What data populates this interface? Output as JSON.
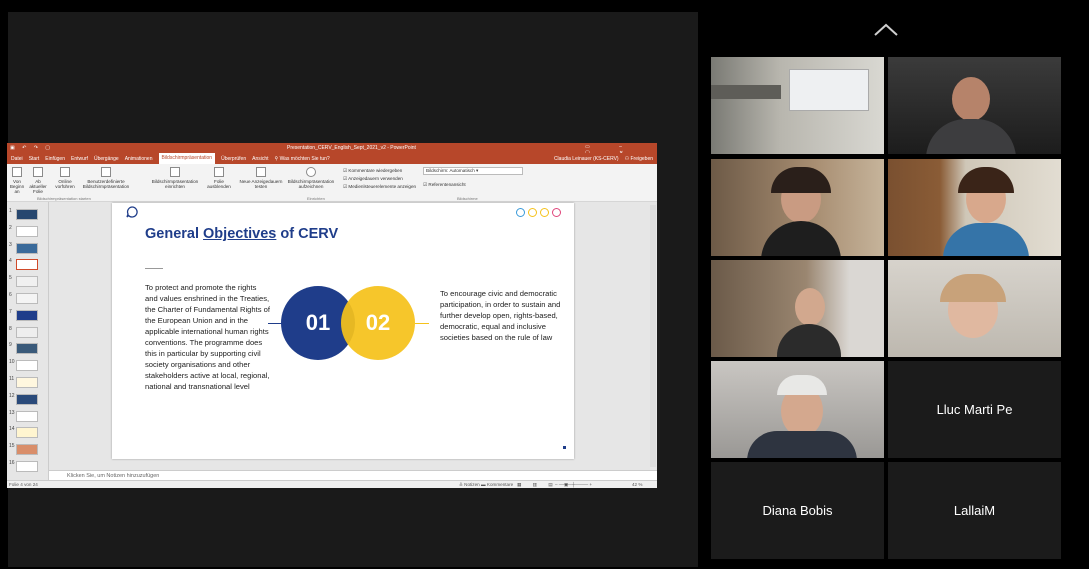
{
  "ppt": {
    "window_title": "Presentation_CERV_English_Sept_2021_v2 - PowerPoint",
    "tabs": [
      "Datei",
      "Start",
      "Einfügen",
      "Entwurf",
      "Übergänge",
      "Animationen",
      "Bildschirmpräsentation",
      "Überprüfen",
      "Ansicht"
    ],
    "tell_me": "Was möchten Sie tun?",
    "user": "Claudia Leinauer (KS-CERV)",
    "share": "Freigeben",
    "ribbon": {
      "from_beginning": "Von Beginn an",
      "from_current": "Ab aktueller Folie",
      "online": "Online vorführen",
      "custom": "Benutzerdefinierte Bildschirmpräsentation",
      "group_start": "Bildschirmpräsentation starten",
      "setup": "Bildschirmpräsentation einrichten",
      "hide": "Folie ausblenden",
      "rehearse": "Neue Anzeigedauern testen",
      "record": "Bildschirmpräsentation aufzeichnen",
      "chk_comments": "Kommentare wiedergeben",
      "chk_timings": "Anzeigedauern verwenden",
      "chk_media": "Medienlsteuerelemente anzeigen",
      "group_setup": "Einrichten",
      "monitor": "Bildschirm: Automatisch",
      "presenter": "Referentenansicht",
      "group_monitors": "Bildschirme"
    },
    "notes_placeholder": "Klicken Sie, um Notizen hinzuzufügen",
    "status_left": "Folie 4 von 24",
    "status_notes": "Notizen",
    "status_comments": "Kommentare",
    "zoom": "42 %",
    "thumb_numbers": [
      "1",
      "2",
      "3",
      "4",
      "5",
      "6",
      "7",
      "8",
      "9",
      "10",
      "11",
      "12",
      "13",
      "14",
      "15",
      "16"
    ]
  },
  "slide": {
    "title_a": "General ",
    "title_b": "Objectives",
    "title_c": " of CERV",
    "left_text": "To protect and promote the rights and values enshrined in the Treaties, the Charter of Fundamental Rights of the European Union and in the applicable international human rights conventions. The programme does this in particular by supporting civil society organisations and other stakeholders active at local, regional, national and transnational level",
    "right_text": "To encourage civic and democratic participation, in order to sustain and further develop open, rights-based, democratic, equal and inclusive societies based on the rule of law",
    "num1": "01",
    "num2": "02",
    "colors": {
      "blue": "#1f3d8a",
      "yellow": "#f5c21b"
    }
  },
  "participants": {
    "p1": "Lluc Marti Pe",
    "p2": "Diana Bobis",
    "p3": "LallaiM"
  }
}
